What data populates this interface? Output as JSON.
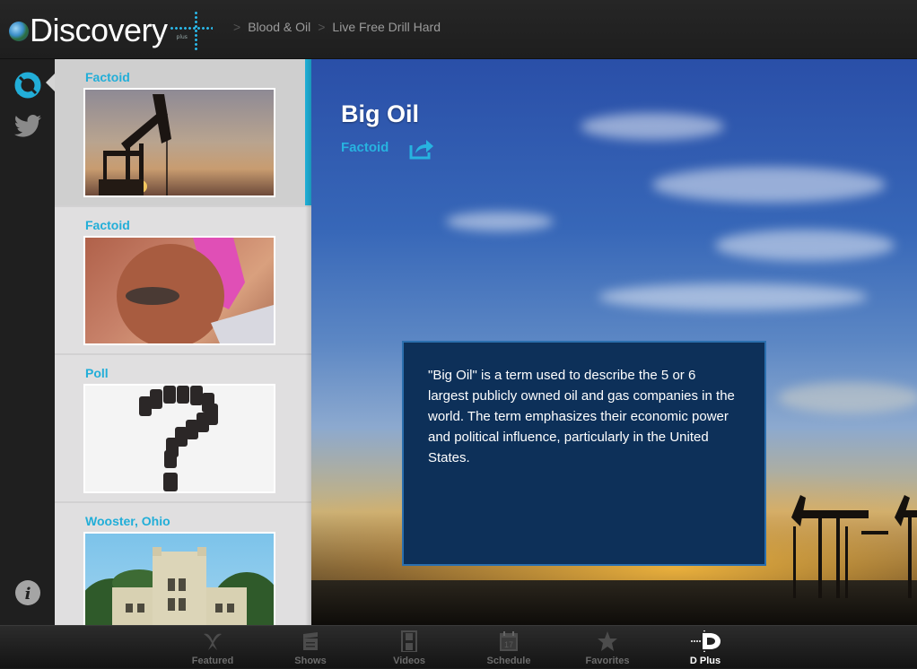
{
  "header": {
    "logo_text": "Discovery",
    "logo_suffix": "plus",
    "breadcrumbs": [
      "Blood & Oil",
      "Live Free Drill Hard"
    ],
    "separator": ">"
  },
  "rail": {
    "items": [
      {
        "icon": "sync-icon",
        "active": true
      },
      {
        "icon": "twitter-icon",
        "active": false
      }
    ],
    "bottom_icon": "info-icon",
    "info_glyph": "i"
  },
  "list": {
    "items": [
      {
        "label": "Factoid",
        "image": "oil pumpjack at sunset",
        "selected": true
      },
      {
        "label": "Factoid",
        "image": "man with pink cap",
        "selected": false
      },
      {
        "label": "Poll",
        "image": "oil barrels forming question mark",
        "selected": false
      },
      {
        "label": "Wooster, Ohio",
        "image": "college building with towers",
        "selected": false
      }
    ]
  },
  "detail": {
    "title": "Big Oil",
    "type": "Factoid",
    "share_icon": "share-icon",
    "body": "\"Big Oil\" is a term used to describe the 5 or 6 largest publicly owned oil and gas companies in the world. The term emphasizes their economic power and political influence, particularly in the United States."
  },
  "tabs": [
    {
      "label": "Featured",
      "icon": "featured-icon",
      "active": false
    },
    {
      "label": "Shows",
      "icon": "clapperboard-icon",
      "active": false
    },
    {
      "label": "Videos",
      "icon": "film-icon",
      "active": false
    },
    {
      "label": "Schedule",
      "icon": "calendar-icon",
      "calendar_day": "17",
      "active": false
    },
    {
      "label": "Favorites",
      "icon": "star-icon",
      "active": false
    },
    {
      "label": "D Plus",
      "icon": "dplus-icon",
      "active": true
    }
  ],
  "colors": {
    "accent": "#22aed8",
    "info_box": "#0d3059",
    "info_border": "#2b6fae",
    "tab_inactive": "#6c6c6c",
    "tab_active": "#ffffff"
  }
}
